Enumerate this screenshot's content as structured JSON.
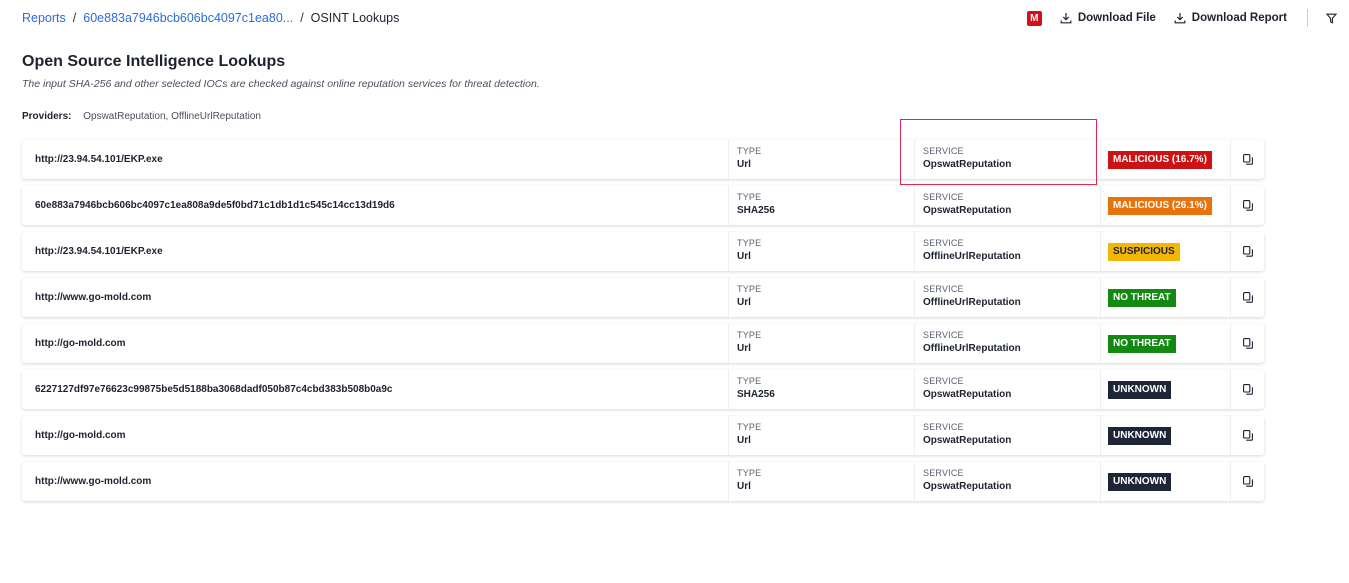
{
  "breadcrumb": {
    "reports": "Reports",
    "sep1": "/",
    "report_id": "60e883a7946bcb606bc4097c1ea80...",
    "sep2": "/",
    "current": "OSINT Lookups"
  },
  "header": {
    "m_badge": "M",
    "download_file": "Download File",
    "download_report": "Download Report"
  },
  "section": {
    "title": "Open Source Intelligence Lookups",
    "description": "The input SHA-256 and other selected IOCs are checked against online reputation services for threat detection.",
    "providers_label": "Providers:",
    "providers_value": "OpswatReputation, OfflineUrlReputation"
  },
  "column_labels": {
    "type": "TYPE",
    "service": "SERVICE"
  },
  "rows": [
    {
      "value": "http://23.94.54.101/EKP.exe",
      "type": "Url",
      "service": "OpswatReputation",
      "verdict": "MALICIOUS (16.7%)",
      "verdict_color": "#cc1212"
    },
    {
      "value": "60e883a7946bcb606bc4097c1ea808a9de5f0bd71c1db1d1c545c14cc13d19d6",
      "type": "SHA256",
      "service": "OpswatReputation",
      "verdict": "MALICIOUS (26.1%)",
      "verdict_color": "#e8720c"
    },
    {
      "value": "http://23.94.54.101/EKP.exe",
      "type": "Url",
      "service": "OfflineUrlReputation",
      "verdict": "SUSPICIOUS",
      "verdict_color": "#f2b705"
    },
    {
      "value": "http://www.go-mold.com",
      "type": "Url",
      "service": "OfflineUrlReputation",
      "verdict": "NO THREAT",
      "verdict_color": "#128a12"
    },
    {
      "value": "http://go-mold.com",
      "type": "Url",
      "service": "OfflineUrlReputation",
      "verdict": "NO THREAT",
      "verdict_color": "#128a12"
    },
    {
      "value": "6227127df97e76623c99875be5d5188ba3068dadf050b87c4cbd383b508b0a9c",
      "type": "SHA256",
      "service": "OpswatReputation",
      "verdict": "UNKNOWN",
      "verdict_color": "#1e2537"
    },
    {
      "value": "http://go-mold.com",
      "type": "Url",
      "service": "OpswatReputation",
      "verdict": "UNKNOWN",
      "verdict_color": "#1e2537"
    },
    {
      "value": "http://www.go-mold.com",
      "type": "Url",
      "service": "OpswatReputation",
      "verdict": "UNKNOWN",
      "verdict_color": "#1e2537"
    }
  ]
}
